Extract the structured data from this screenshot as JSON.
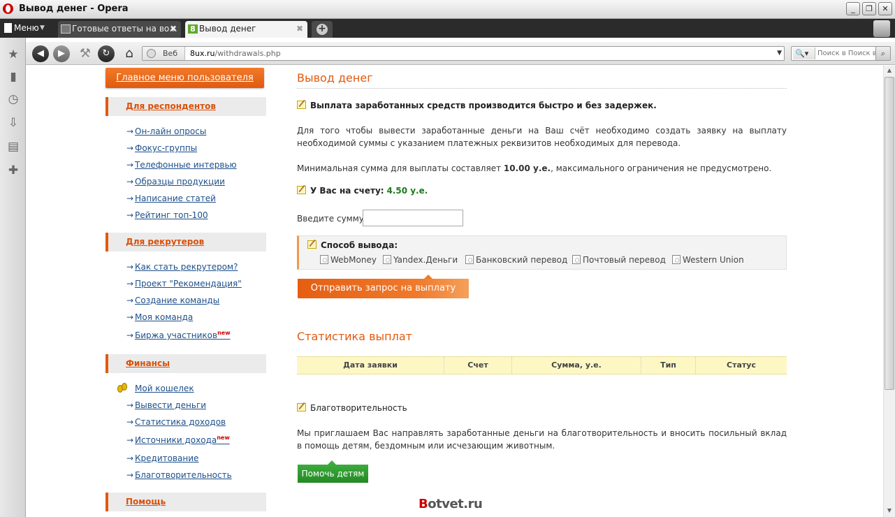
{
  "window": {
    "title": "Вывод денег - Opera"
  },
  "tabbar": {
    "menu_label": "Меню",
    "tabs": [
      {
        "label": "Готовые ответы на во..."
      },
      {
        "label": "Вывод денег"
      }
    ]
  },
  "address": {
    "scheme_label": "Веб",
    "domain": "8ux.ru",
    "path": "/withdrawals.php",
    "search_placeholder": "Поиск в Поиск в Инте"
  },
  "sidebar": {
    "main_button": "Главное меню пользователя",
    "sections": [
      {
        "title": "Для респондентов",
        "items": [
          "Он-лайн опросы",
          "Фокус-группы",
          "Телефонные интервью",
          "Образцы продукции",
          "Написание статей",
          "Рейтинг топ-100"
        ]
      },
      {
        "title": "Для рекрутеров",
        "items": [
          "Как стать рекрутером?",
          "Проект \"Рекомендация\"",
          "Создание команды",
          "Моя команда",
          "Биржа участников"
        ]
      },
      {
        "title": "Финансы",
        "items": [
          "Мой кошелек",
          "Вывести деньги",
          "Статистика доходов",
          "Источники дохода",
          "Кредитование",
          "Благотворительность"
        ]
      },
      {
        "title": "Помощь"
      }
    ],
    "new_badge": "new"
  },
  "content": {
    "title": "Вывод денег",
    "fast_payout": "Выплата заработанных средств производится быстро и без задержек.",
    "instructions": "Для того чтобы вывести заработанные деньги на Ваш счёт необходимо создать заявку на выплату необходимой суммы с указанием платежных реквизитов необходимых для перевода.",
    "min_prefix": "Минимальная сумма для выплаты составляет ",
    "min_amount": "10.00 у.е.",
    "min_suffix": ", максимального ограничения не предусмотрено.",
    "balance_label": "У Вас на счету:",
    "balance_value": "4.50 у.е.",
    "amount_label": "Введите сумму:",
    "method_title": "Способ вывода:",
    "methods": [
      "WebMoney",
      "Yandex.Деньги",
      "Банковский перевод",
      "Почтовый перевод",
      "Western Union"
    ],
    "submit_label": "Отправить запрос на выплату",
    "stats_title": "Статистика выплат",
    "stats_columns": [
      "Дата заявки",
      "Счет",
      "Сумма, у.е.",
      "Тип",
      "Статус"
    ],
    "charity_title": "Благотворительность",
    "charity_text": "Мы приглашаем Вас направлять заработанные деньги на благотворительность и вносить посильный вклад в помощь детям, бездомным или исчезающим животным.",
    "help_button": "Помочь детям"
  },
  "watermark": {
    "first": "B",
    "rest": "otvet.ru"
  }
}
